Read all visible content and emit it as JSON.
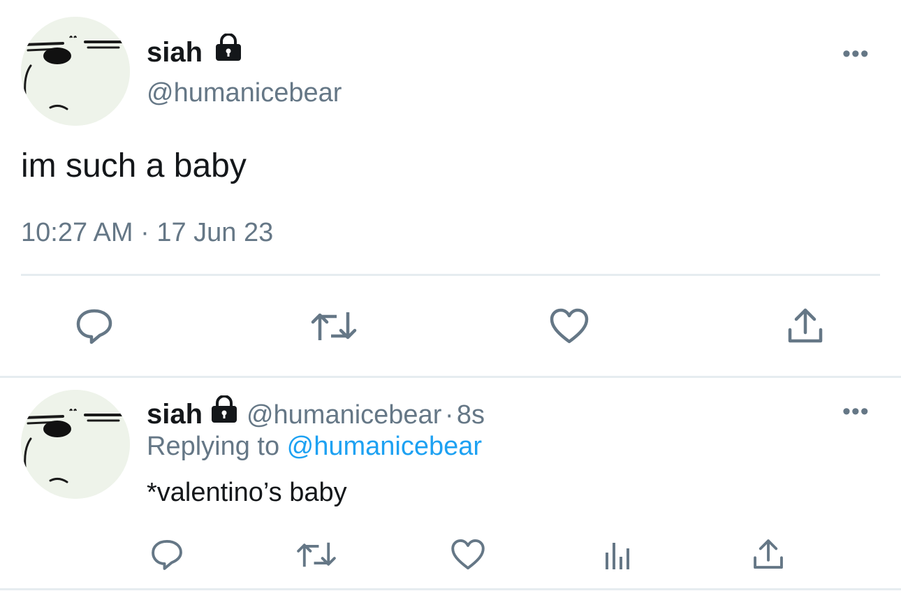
{
  "main_tweet": {
    "display_name": "siah",
    "handle": "@humanicebear",
    "text": "im such a baby",
    "timestamp": "10:27 AM · 17 Jun 23",
    "more_label": "•••"
  },
  "reply_tweet": {
    "display_name": "siah",
    "handle": "@humanicebear",
    "separator": "·",
    "age": "8s",
    "replying_prefix": "Replying to ",
    "replying_to": "@humanicebear",
    "text": "*valentino’s baby",
    "more_label": "•••"
  },
  "icons": {
    "reply": "reply-bubble-icon",
    "retweet": "retweet-icon",
    "like": "heart-icon",
    "share": "share-icon",
    "analytics": "analytics-bars-icon",
    "lock": "lock-icon"
  },
  "colors": {
    "text_primary": "#14171a",
    "text_secondary": "#657786",
    "link": "#1da1f2",
    "divider": "#e6ecf0",
    "avatar_bg": "#eef3ea"
  }
}
